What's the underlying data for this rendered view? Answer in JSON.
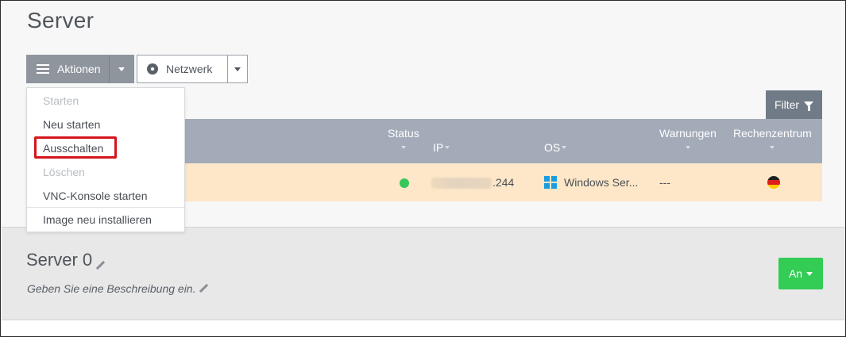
{
  "page": {
    "title": "Server"
  },
  "toolbar": {
    "actions_label": "Aktionen",
    "network_label": "Netzwerk",
    "filter_label": "Filter"
  },
  "actions_menu": {
    "items": [
      {
        "label": "Starten",
        "disabled": true
      },
      {
        "label": "Neu starten",
        "disabled": false
      },
      {
        "label": "Ausschalten",
        "disabled": false,
        "highlighted": true
      },
      {
        "label": "Löschen",
        "disabled": true
      },
      {
        "label": "VNC-Konsole starten",
        "disabled": false
      },
      {
        "label": "Image neu installieren",
        "disabled": false
      }
    ]
  },
  "table": {
    "columns": {
      "status": "Status",
      "ip": "IP",
      "os": "OS",
      "warnings": "Warnungen",
      "datacenter": "Rechenzentrum"
    },
    "rows": [
      {
        "status": "online",
        "ip_suffix": ".244",
        "os": "Windows Ser...",
        "warnings": "---",
        "datacenter_flag": "germany-flag-icon"
      }
    ]
  },
  "server_detail": {
    "name": "Server 0",
    "description_placeholder": "Geben Sie eine Beschreibung ein.",
    "power_label": "An"
  },
  "colors": {
    "table_header": "#a3abb9",
    "row_highlight": "#fde7c8",
    "status_online": "#35c759",
    "power_on": "#33cc55",
    "highlight_border": "#d4161b"
  }
}
